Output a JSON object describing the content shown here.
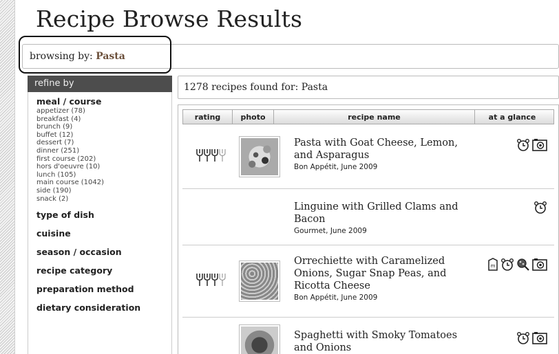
{
  "page": {
    "title": "Recipe Browse Results"
  },
  "browse": {
    "prefix": "browsing by:",
    "value": "Pasta"
  },
  "sidebar": {
    "header": "refine by",
    "meal_title": "meal / course",
    "meal_items": [
      "appetizer (78)",
      "breakfast (4)",
      "brunch (9)",
      "buffet (12)",
      "dessert (7)",
      "dinner (251)",
      "first course (202)",
      "hors d'oeuvre (10)",
      "lunch (105)",
      "main course (1042)",
      "side (190)",
      "snack (2)"
    ],
    "categories": [
      "type of dish",
      "cuisine",
      "season / occasion",
      "recipe category",
      "preparation method",
      "dietary consideration"
    ]
  },
  "results": {
    "count_text": "1278 recipes found for: Pasta",
    "headers": {
      "rating": "rating",
      "photo": "photo",
      "name": "recipe name",
      "glance": "at a glance"
    },
    "rows": [
      {
        "name": "Pasta with Goat Cheese, Lemon, and Asparagus",
        "source": "Bon Appétit, June 2009",
        "forks": 3,
        "icons": [
          "quick-clock-icon",
          "photo-icon"
        ]
      },
      {
        "name": "Linguine with Grilled Clams and Bacon",
        "source": "Gourmet, June 2009",
        "forks": 0,
        "icons": [
          "quick-clock-icon"
        ]
      },
      {
        "name": "Orrechiette with Caramelized Onions, Sugar Snap Peas, and Ricotta Cheese",
        "source": "Bon Appétit, June 2009",
        "forks": 3,
        "icons": [
          "menu-card-icon",
          "quick-clock-icon",
          "vegetarian-icon",
          "photo-icon"
        ]
      },
      {
        "name": "Spaghetti with Smoky Tomatoes and Onions",
        "source": "",
        "forks": 0,
        "icons": [
          "quick-clock-icon",
          "photo-icon"
        ]
      }
    ]
  }
}
